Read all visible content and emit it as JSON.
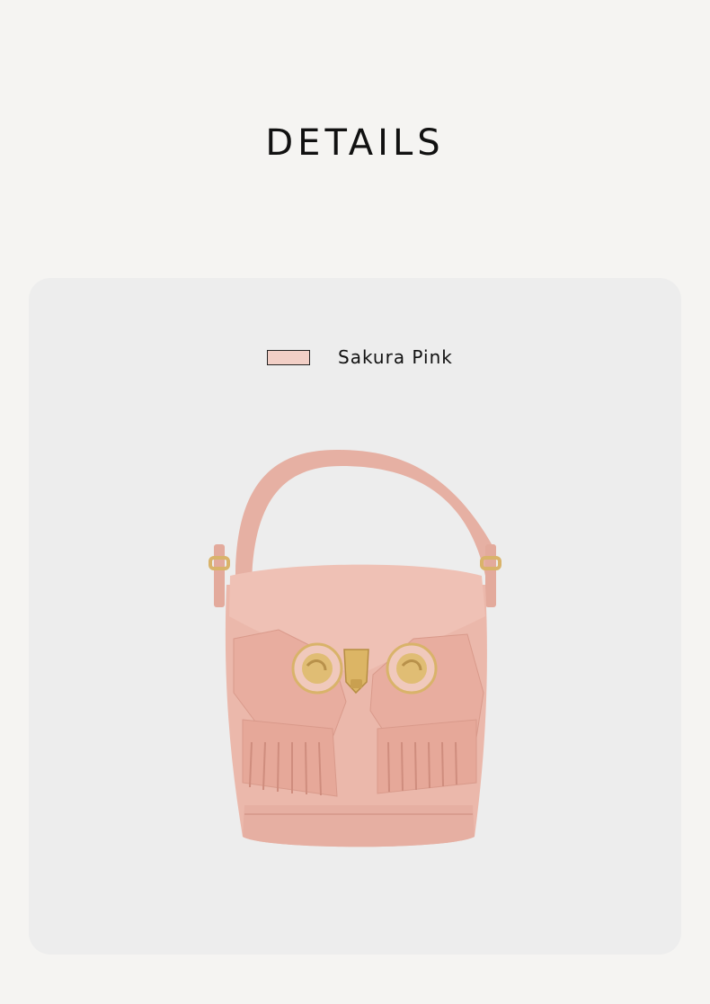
{
  "header": {
    "title": "DETAILS"
  },
  "color_option": {
    "label": "Sakura Pink",
    "swatch_color": "#f2cfc6"
  },
  "product": {
    "image_description_icon": "owl-bucket-bag-image",
    "bag_color": "#e9b5a8",
    "hardware_color": "#d9b36a"
  },
  "colors": {
    "page_background": "#f5f4f2",
    "card_background": "#ededed",
    "text": "#111111"
  }
}
